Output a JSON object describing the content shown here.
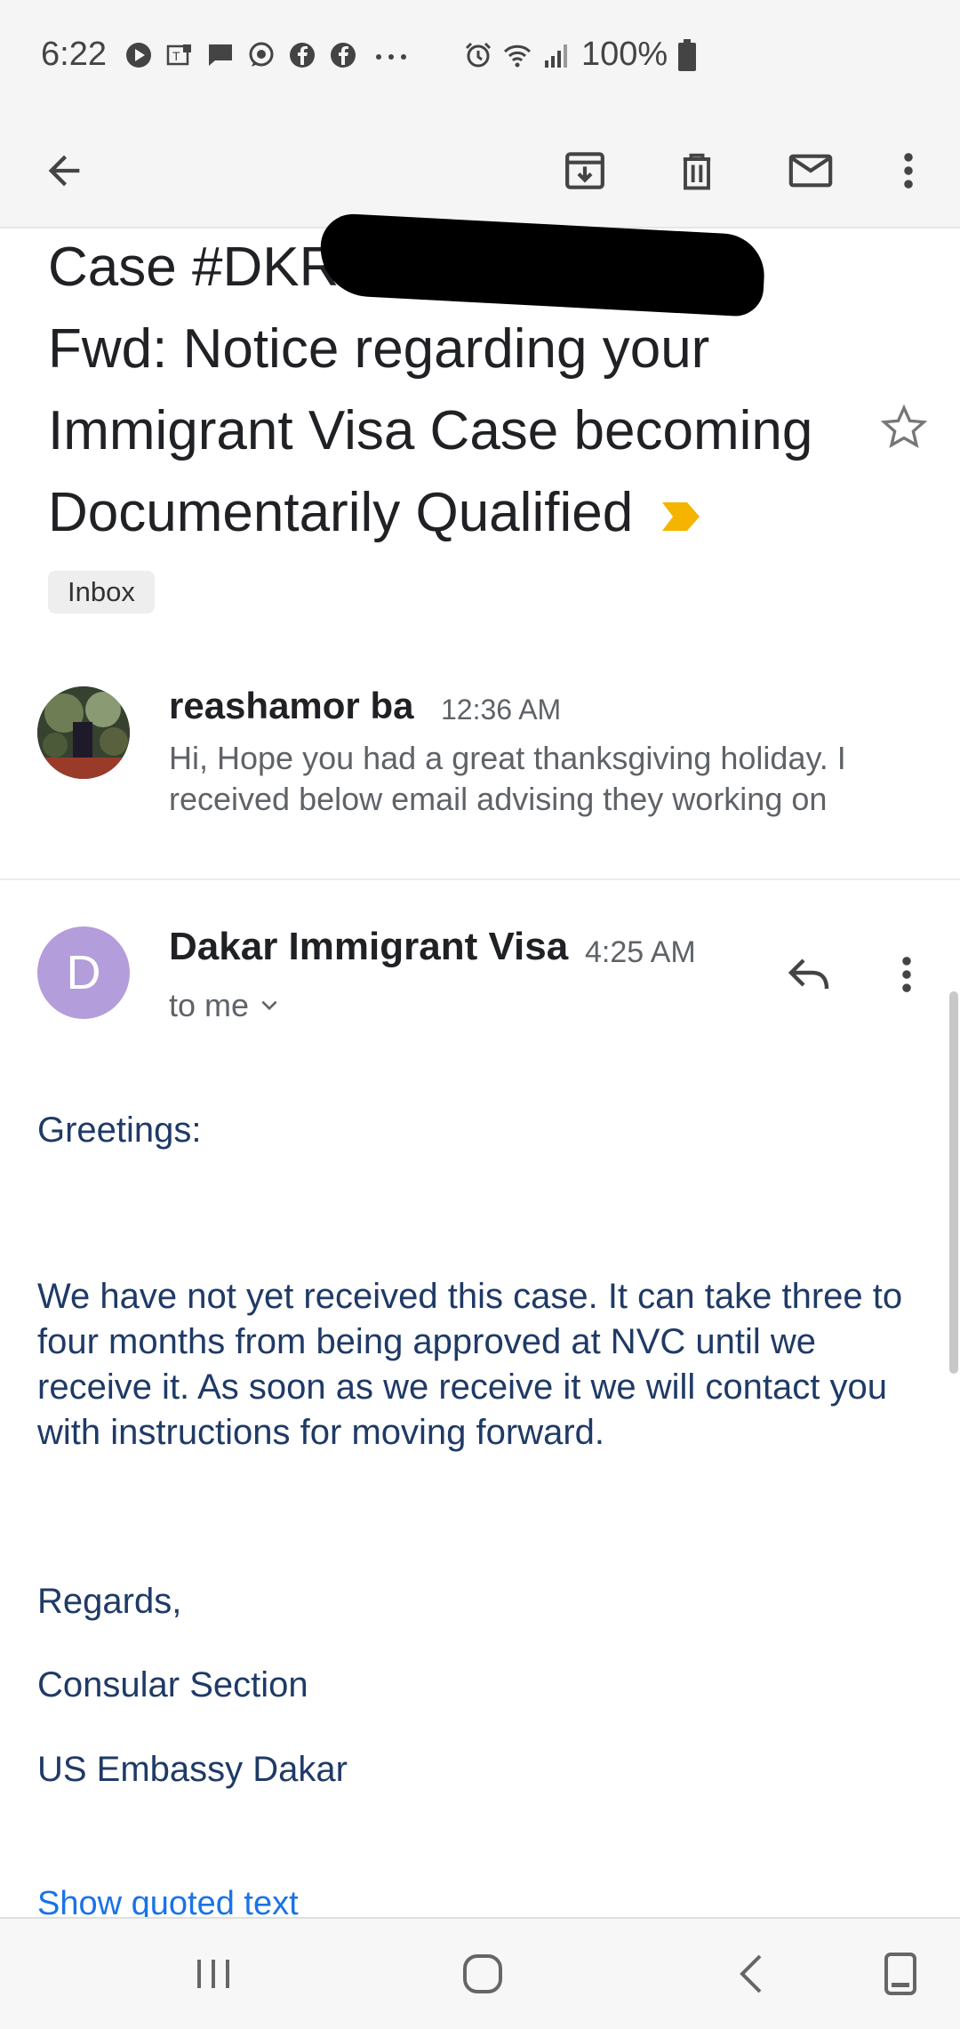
{
  "status_bar": {
    "time": "6:22",
    "battery": "100%",
    "icons": [
      "play-icon",
      "teams-icon",
      "message-icon",
      "whatsapp-icon",
      "facebook-icon",
      "facebook-icon",
      "more-notifications-icon",
      "alarm-icon",
      "wifi-icon",
      "signal-icon",
      "battery-icon"
    ]
  },
  "toolbar": {
    "icons": [
      "back-arrow-icon",
      "archive-icon",
      "delete-icon",
      "mark-unread-icon",
      "more-vert-icon"
    ]
  },
  "email": {
    "subject_line1": "Case #DKR",
    "subject_rest": "Fwd: Notice regarding your Immigrant Visa Case becoming Documentarily Qualified",
    "label": "Inbox",
    "important_color": "#f4b400"
  },
  "messages": [
    {
      "sender": "reashamor ba",
      "time": "12:36 AM",
      "snippet": "Hi, Hope you had a great thanksgiving holiday. I received below email advising they working on"
    },
    {
      "sender": "Dakar Immigrant Visa",
      "avatar_letter": "D",
      "time": "4:25 AM",
      "recipient": "to me",
      "body": {
        "greeting": "Greetings:",
        "paragraph": "We have not yet received this case. It can take three to four months from being approved at NVC until we receive it. As soon as we receive it we will contact you with instructions for moving forward.",
        "regards": "Regards,",
        "sig1": "Consular Section",
        "sig2": "US Embassy Dakar"
      },
      "show_quoted": "Show quoted text"
    }
  ],
  "colors": {
    "accent_avatar": "#b39ddb",
    "body_text": "#1f3a66",
    "link": "#1a73e8"
  }
}
